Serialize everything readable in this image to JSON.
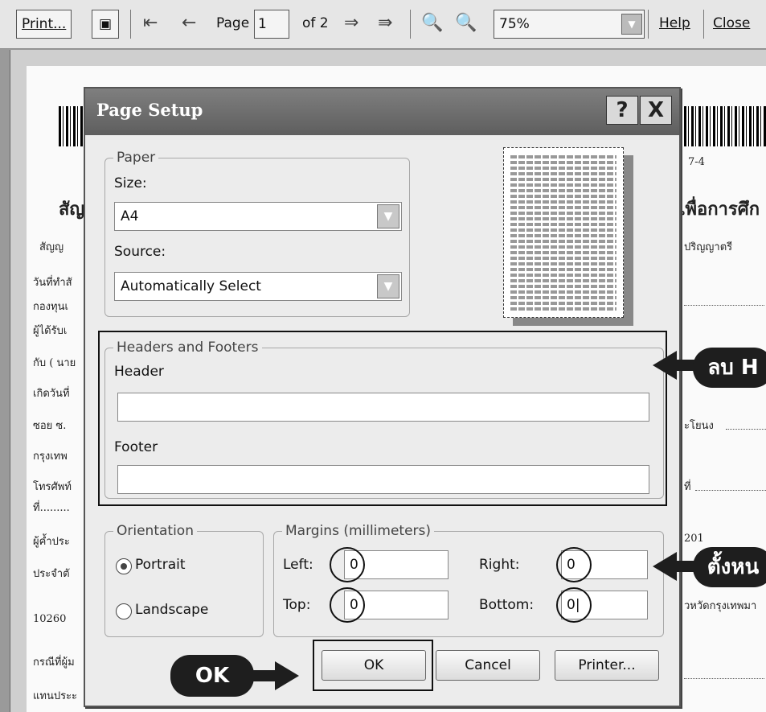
{
  "toolbar": {
    "print_label": "Print...",
    "page_label": "Page",
    "page_value": "1",
    "page_total": "of 2",
    "zoom_value": "75%",
    "help_label": "Help",
    "close_label": "Close",
    "icons": [
      "page-setup-icon",
      "first-page-icon",
      "prev-page-icon",
      "next-page-icon",
      "last-page-icon",
      "zoom-out-icon",
      "zoom-in-icon"
    ]
  },
  "background_doc": {
    "heading_left": "สัญ",
    "heading_right": "เพื่อการศึก",
    "code_right": "7-4",
    "lines_left": [
      "สัญญ",
      "วันที่ทำสั",
      "กองทุนเ",
      "ผู้ได้รับเ",
      "กับ ( นาย",
      "เกิดวันที่",
      "ซอย ซ.",
      "กรุงเทพ",
      "โทรศัพท์",
      "ที่.........",
      "ผู้ค้ำประ",
      "ประจำตั",
      "10260",
      "กรณีที่ผู้ม",
      "แทนประะ"
    ],
    "lines_right": [
      "ปริญญาตรี",
      "ะโยนง",
      "ที่",
      "201",
      "วหวัดกรุงเทพมา"
    ]
  },
  "dialog": {
    "title": "Page Setup",
    "help_btn": "?",
    "close_btn": "X",
    "paper": {
      "legend": "Paper",
      "size_label": "Size:",
      "size_value": "A4",
      "source_label": "Source:",
      "source_value": "Automatically Select"
    },
    "headers_footers": {
      "legend": "Headers and Footers",
      "header_label": "Header",
      "header_value": "",
      "footer_label": "Footer",
      "footer_value": ""
    },
    "orientation": {
      "legend": "Orientation",
      "portrait": "Portrait",
      "landscape": "Landscape",
      "selected": "Portrait"
    },
    "margins": {
      "legend": "Margins (millimeters)",
      "left_label": "Left:",
      "left_value": "0",
      "right_label": "Right:",
      "right_value": "0",
      "top_label": "Top:",
      "top_value": "0",
      "bottom_label": "Bottom:",
      "bottom_value": "0|"
    },
    "buttons": {
      "ok": "OK",
      "cancel": "Cancel",
      "printer": "Printer..."
    }
  },
  "callouts": {
    "headers": "ลบ H",
    "margins": "ตั้งหน",
    "ok": "OK"
  },
  "colors": {
    "callout": "#1e1e1e",
    "titlebar": "#6e6e6e",
    "dialog_bg": "#ececec"
  }
}
